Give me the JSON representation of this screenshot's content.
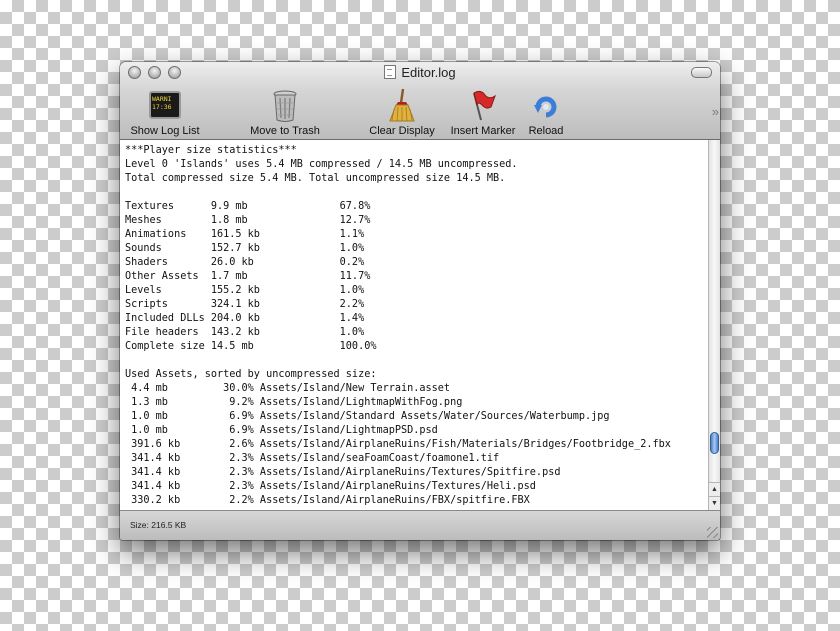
{
  "window": {
    "title": "Editor.log"
  },
  "toolbar": {
    "show_log_list": "Show Log List",
    "move_to_trash": "Move to Trash",
    "clear_display": "Clear Display",
    "insert_marker": "Insert Marker",
    "reload": "Reload",
    "console_icon_text": "WARNI\n17:36",
    "overflow": "»"
  },
  "log": {
    "lines": [
      "***Player size statistics***",
      "Level 0 'Islands' uses 5.4 MB compressed / 14.5 MB uncompressed.",
      "Total compressed size 5.4 MB. Total uncompressed size 14.5 MB.",
      "",
      "Textures      9.9 mb               67.8%",
      "Meshes        1.8 mb               12.7%",
      "Animations    161.5 kb             1.1%",
      "Sounds        152.7 kb             1.0%",
      "Shaders       26.0 kb              0.2%",
      "Other Assets  1.7 mb               11.7%",
      "Levels        155.2 kb             1.0%",
      "Scripts       324.1 kb             2.2%",
      "Included DLLs 204.0 kb             1.4%",
      "File headers  143.2 kb             1.0%",
      "Complete size 14.5 mb              100.0%",
      "",
      "Used Assets, sorted by uncompressed size:",
      " 4.4 mb         30.0% Assets/Island/New Terrain.asset",
      " 1.3 mb          9.2% Assets/Island/LightmapWithFog.png",
      " 1.0 mb          6.9% Assets/Island/Standard Assets/Water/Sources/Waterbump.jpg",
      " 1.0 mb          6.9% Assets/Island/LightmapPSD.psd",
      " 391.6 kb        2.6% Assets/Island/AirplaneRuins/Fish/Materials/Bridges/Footbridge_2.fbx",
      " 341.4 kb        2.3% Assets/Island/seaFoamCoast/foamone1.tif",
      " 341.4 kb        2.3% Assets/Island/AirplaneRuins/Textures/Spitfire.psd",
      " 341.4 kb        2.3% Assets/Island/AirplaneRuins/Textures/Heli.psd",
      " 330.2 kb        2.2% Assets/Island/AirplaneRuins/FBX/spitfire.FBX"
    ]
  },
  "scrollbar": {
    "up_arrow": "▲",
    "down_arrow": "▼"
  },
  "status": {
    "size": "Size: 216.5 KB"
  }
}
